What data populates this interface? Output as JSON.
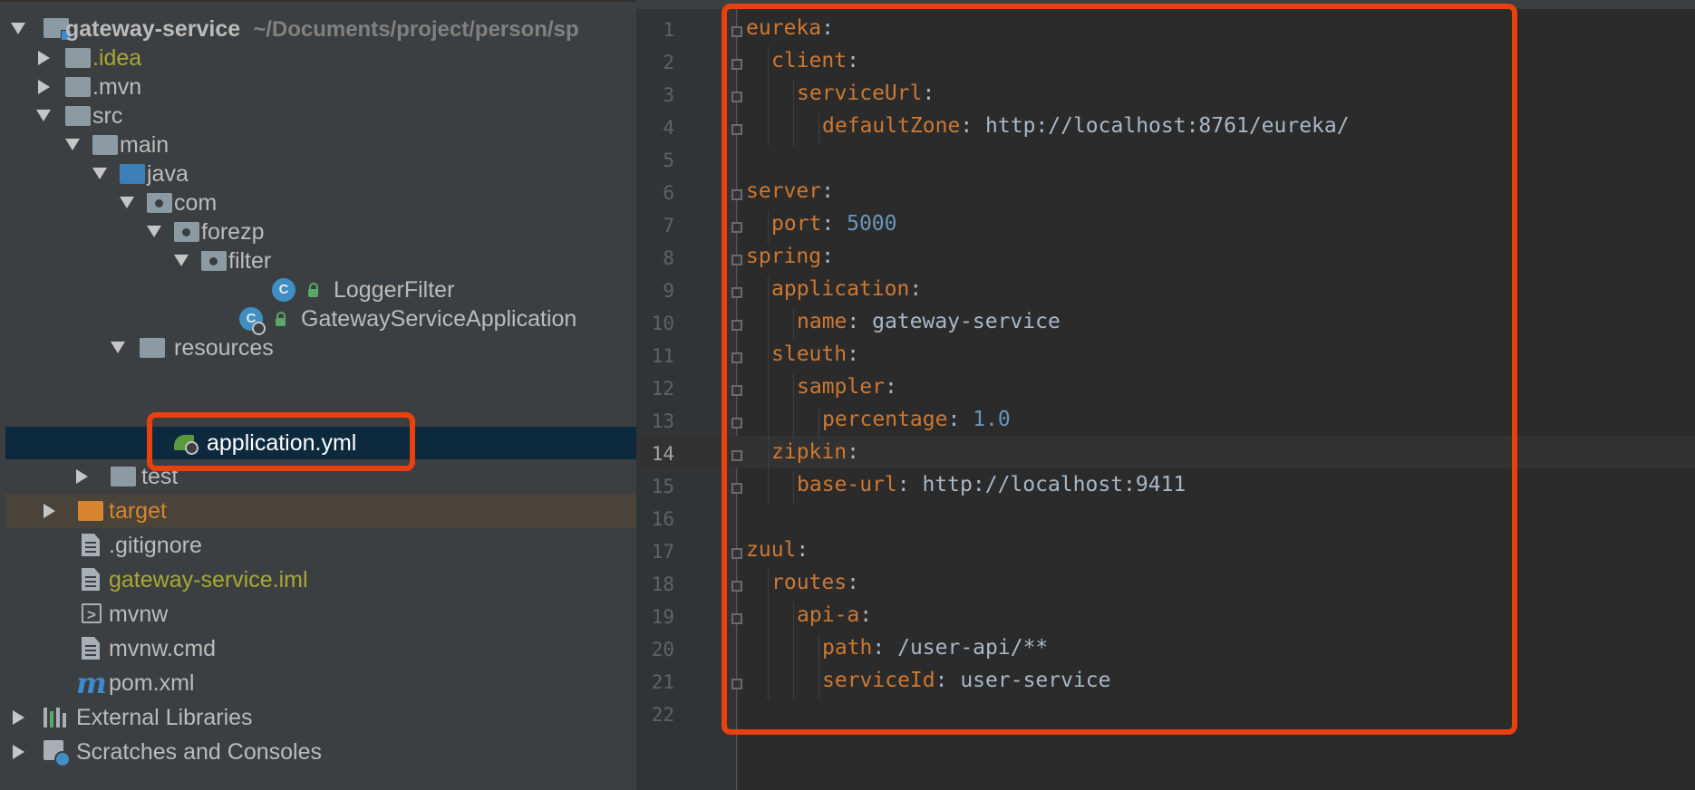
{
  "project_tree": {
    "root": {
      "name": "gateway-service",
      "path": "~/Documents/project/person/sp"
    },
    "items": [
      {
        "label": ".idea"
      },
      {
        "label": ".mvn"
      },
      {
        "label": "src"
      },
      {
        "label": "main"
      },
      {
        "label": "java"
      },
      {
        "label": "com"
      },
      {
        "label": "forezp"
      },
      {
        "label": "filter"
      },
      {
        "label": "LoggerFilter",
        "icon_letter": "C"
      },
      {
        "label": "GatewayServiceApplication",
        "icon_letter": "C"
      },
      {
        "label": "resources"
      },
      {
        "label": "application.yml"
      },
      {
        "label": "test"
      },
      {
        "label": "target"
      },
      {
        "label": ".gitignore"
      },
      {
        "label": "gateway-service.iml"
      },
      {
        "label": "mvnw"
      },
      {
        "label": "mvnw.cmd"
      },
      {
        "label": "pom.xml",
        "icon_letter": "m"
      },
      {
        "label": "External Libraries"
      },
      {
        "label": "Scratches and Consoles"
      }
    ]
  },
  "editor": {
    "file": "application.yml",
    "active_line": "14",
    "line_numbers": [
      "1",
      "2",
      "3",
      "4",
      "5",
      "6",
      "7",
      "8",
      "9",
      "10",
      "11",
      "12",
      "13",
      "14",
      "15",
      "16",
      "17",
      "18",
      "19",
      "20",
      "21",
      "22"
    ],
    "lines": [
      {
        "key": "eureka",
        "sep": ":",
        "value": ""
      },
      {
        "key": "client",
        "sep": ":",
        "value": ""
      },
      {
        "key": "serviceUrl",
        "sep": ":",
        "value": ""
      },
      {
        "key": "defaultZone",
        "sep": ": ",
        "value": "http://localhost:8761/eureka/"
      },
      {
        "key": "",
        "sep": "",
        "value": ""
      },
      {
        "key": "server",
        "sep": ":",
        "value": ""
      },
      {
        "key": "port",
        "sep": ": ",
        "value": "5000"
      },
      {
        "key": "spring",
        "sep": ":",
        "value": ""
      },
      {
        "key": "application",
        "sep": ":",
        "value": ""
      },
      {
        "key": "name",
        "sep": ": ",
        "value": "gateway-service"
      },
      {
        "key": "sleuth",
        "sep": ":",
        "value": ""
      },
      {
        "key": "sampler",
        "sep": ":",
        "value": ""
      },
      {
        "key": "percentage",
        "sep": ": ",
        "value": "1.0"
      },
      {
        "key": "zipkin",
        "sep": ":",
        "value": ""
      },
      {
        "key": "base-url",
        "sep": ": ",
        "value": "http://localhost:9411"
      },
      {
        "key": "",
        "sep": "",
        "value": ""
      },
      {
        "key": "zuul",
        "sep": ":",
        "value": ""
      },
      {
        "key": "routes",
        "sep": ":",
        "value": ""
      },
      {
        "key": "api-a",
        "sep": ":",
        "value": ""
      },
      {
        "key": "path",
        "sep": ": ",
        "value": "/user-api/**"
      },
      {
        "key": "serviceId",
        "sep": ": ",
        "value": "user-service"
      },
      {
        "key": "",
        "sep": "",
        "value": ""
      }
    ]
  },
  "colors": {
    "tree_bg": "#3c3f41",
    "editor_bg": "#2b2b2b",
    "yaml_key": "#cc7832",
    "yaml_number": "#6897bb",
    "yaml_text": "#a9b7c6",
    "highlight_box": "#e8400f",
    "selection": "#0d293e"
  }
}
